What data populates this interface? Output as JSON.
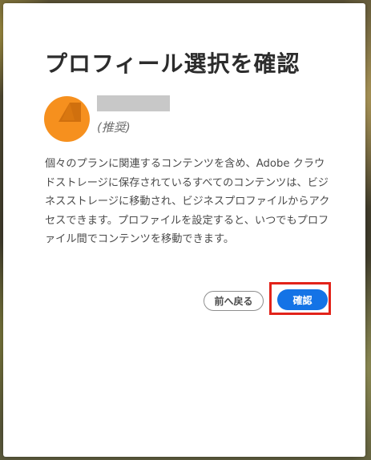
{
  "dialog": {
    "title": "プロフィール選択を確認",
    "profile": {
      "recommended_label": "(推奨)",
      "avatar_icon": "person-avatar-icon",
      "avatar_color": "#f6901e"
    },
    "description": "個々のプランに関連するコンテンツを含め、Adobe クラウドストレージに保存されているすべてのコンテンツは、ビジネスストレージに移動され、ビジネスプロファイルからアクセスできます。プロファイルを設定すると、いつでもプロファイル間でコンテンツを移動できます。",
    "buttons": {
      "back_label": "前へ戻る",
      "confirm_label": "確認"
    }
  },
  "colors": {
    "primary_button": "#1473e6",
    "highlight_box": "#e2231a"
  }
}
